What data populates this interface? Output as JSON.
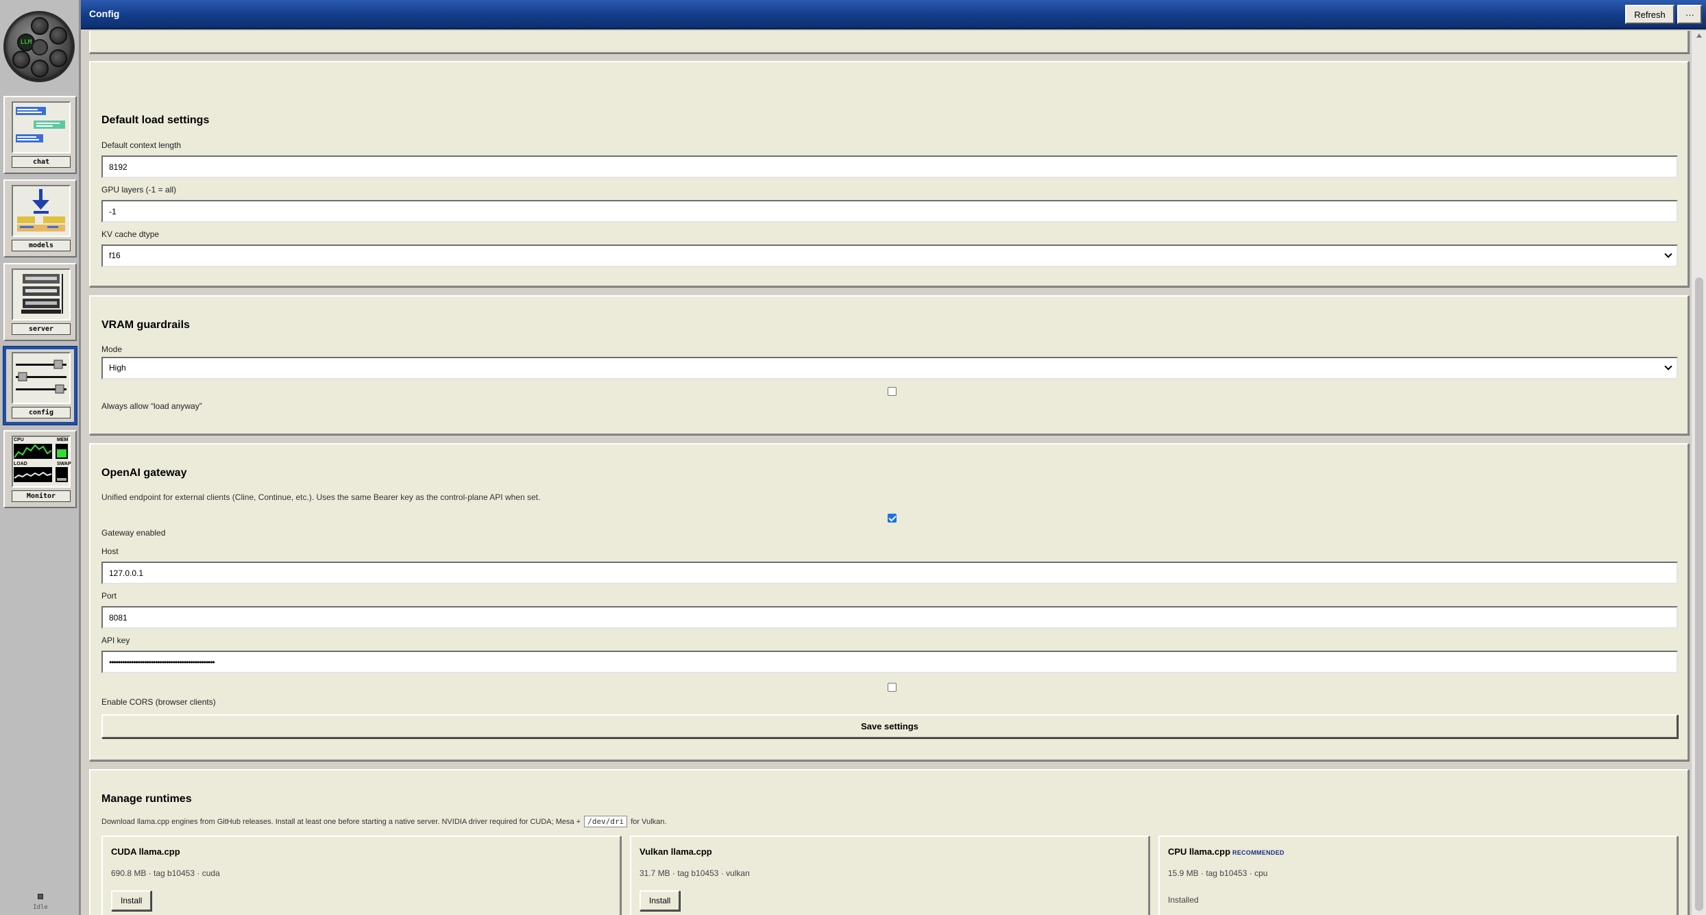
{
  "window": {
    "title": "Config",
    "refresh_label": "Refresh",
    "more_label": "···"
  },
  "sidebar": {
    "logo_text": "LLM",
    "items": [
      {
        "label": "chat",
        "icon": "chat-icon"
      },
      {
        "label": "models",
        "icon": "models-icon"
      },
      {
        "label": "server",
        "icon": "server-icon"
      },
      {
        "label": "config",
        "icon": "config-icon",
        "active": true
      },
      {
        "label": "Monitor",
        "icon": "monitor-icon",
        "sublabels": [
          "CPU",
          "MEM",
          "LOAD",
          "SWAP"
        ]
      }
    ],
    "status": "Idle"
  },
  "load_settings": {
    "heading": "Default load settings",
    "context_label": "Default context length",
    "context_value": "8192",
    "gpu_label": "GPU layers (-1 = all)",
    "gpu_value": "-1",
    "kv_label": "KV cache dtype",
    "kv_value": "f16"
  },
  "vram": {
    "heading": "VRAM guardrails",
    "mode_label": "Mode",
    "mode_value": "High",
    "allow_label": "Always allow “load anyway”",
    "allow_checked": false
  },
  "gateway": {
    "heading": "OpenAI gateway",
    "description": "Unified endpoint for external clients (Cline, Continue, etc.). Uses the same Bearer key as the control-plane API when set.",
    "enabled_label": "Gateway enabled",
    "enabled_checked": true,
    "host_label": "Host",
    "host_value": "127.0.0.1",
    "port_label": "Port",
    "port_value": "8081",
    "apikey_label": "API key",
    "apikey_value": "••••••••••••••••••••••••••••••••••••••••••••••••",
    "cors_label": "Enable CORS (browser clients)",
    "cors_checked": false,
    "save_label": "Save settings"
  },
  "runtimes": {
    "heading": "Manage runtimes",
    "desc_before": "Download llama.cpp engines from GitHub releases. Install at least one before starting a native server. NVIDIA driver required for CUDA; Mesa +",
    "desc_code": "/dev/dri",
    "desc_after": "for Vulkan.",
    "items": [
      {
        "name": "CUDA llama.cpp",
        "badge": "",
        "meta": "690.8 MB · tag b10453 · cuda",
        "action": "Install"
      },
      {
        "name": "Vulkan llama.cpp",
        "badge": "",
        "meta": "31.7 MB · tag b10453 · vulkan",
        "action": "Install"
      },
      {
        "name": "CPU llama.cpp",
        "badge": "RECOMMENDED",
        "meta": "15.9 MB · tag b10453 · cpu",
        "status": "Installed"
      }
    ]
  }
}
